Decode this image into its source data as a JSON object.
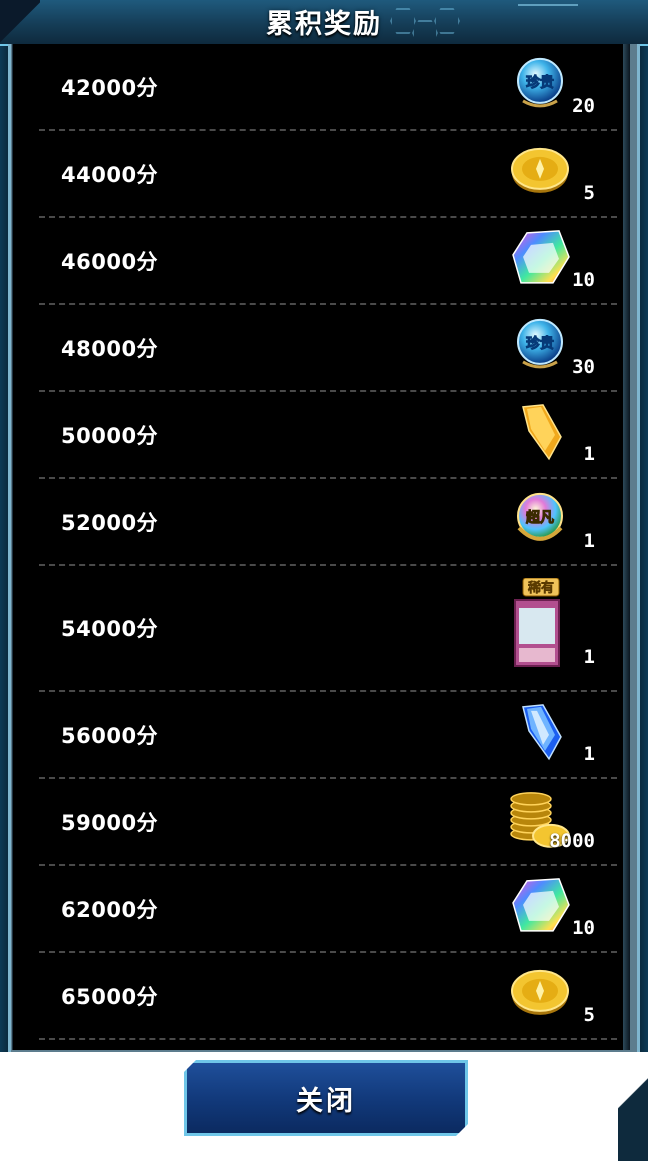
{
  "header": {
    "title": "累积奖励"
  },
  "rewards": [
    {
      "score": "42000分",
      "qty": "20",
      "icon": "gem-orb-icon"
    },
    {
      "score": "44000分",
      "qty": "5",
      "icon": "gold-coin-icon"
    },
    {
      "score": "46000分",
      "qty": "10",
      "icon": "rainbow-crystal-icon"
    },
    {
      "score": "48000分",
      "qty": "30",
      "icon": "gem-orb-icon"
    },
    {
      "score": "50000分",
      "qty": "1",
      "icon": "gold-shard-icon"
    },
    {
      "score": "52000分",
      "qty": "1",
      "icon": "ultra-orb-icon"
    },
    {
      "score": "54000分",
      "qty": "1",
      "icon": "rare-card-icon",
      "badge": "稀有"
    },
    {
      "score": "56000分",
      "qty": "1",
      "icon": "blue-shard-icon"
    },
    {
      "score": "59000分",
      "qty": "8000",
      "icon": "coin-stack-icon"
    },
    {
      "score": "62000分",
      "qty": "10",
      "icon": "rainbow-crystal-icon"
    },
    {
      "score": "65000分",
      "qty": "5",
      "icon": "gold-coin-icon"
    }
  ],
  "orb_labels": {
    "gem": "珍贵",
    "ultra": "超凡"
  },
  "footer": {
    "close_label": "关闭"
  },
  "colors": {
    "frame_accent": "#6fc6e8",
    "button_blue": "#123a7c",
    "list_bg": "#000000"
  }
}
